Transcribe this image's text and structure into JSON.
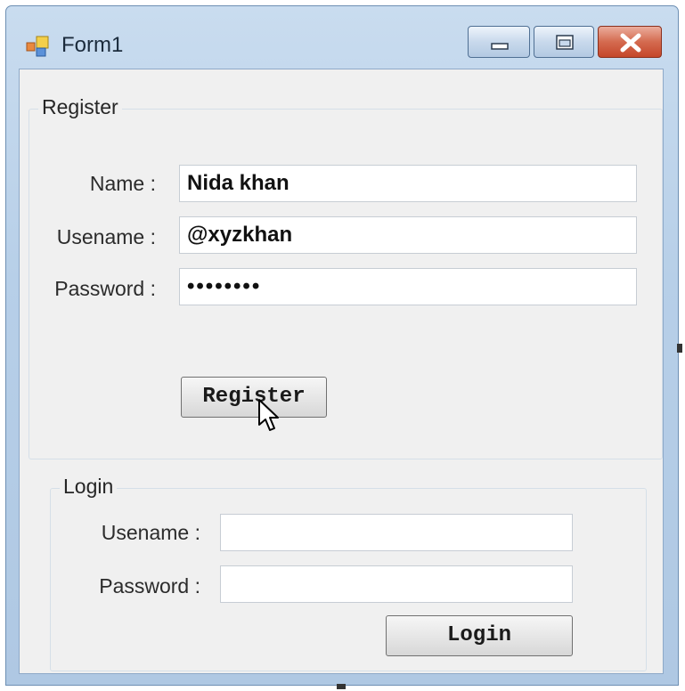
{
  "window": {
    "title": "Form1",
    "icons": {
      "app": "form-app-icon",
      "minimize": "minimize-icon",
      "maximize": "maximize-icon",
      "close": "close-icon"
    }
  },
  "register": {
    "group_label": "Register",
    "name_label": "Name :",
    "name_value": "Nida khan",
    "username_label": "Usename :",
    "username_value": "@xyzkhan",
    "password_label": "Password :",
    "password_value": "••••••••",
    "register_button": "Register"
  },
  "login": {
    "group_label": "Login",
    "username_label": "Usename :",
    "username_value": "",
    "password_label": "Password :",
    "password_value": "",
    "login_button": "Login"
  },
  "colors": {
    "frame": "#b7cfe8",
    "client": "#f0f0f0",
    "close_button": "#c5472b"
  }
}
